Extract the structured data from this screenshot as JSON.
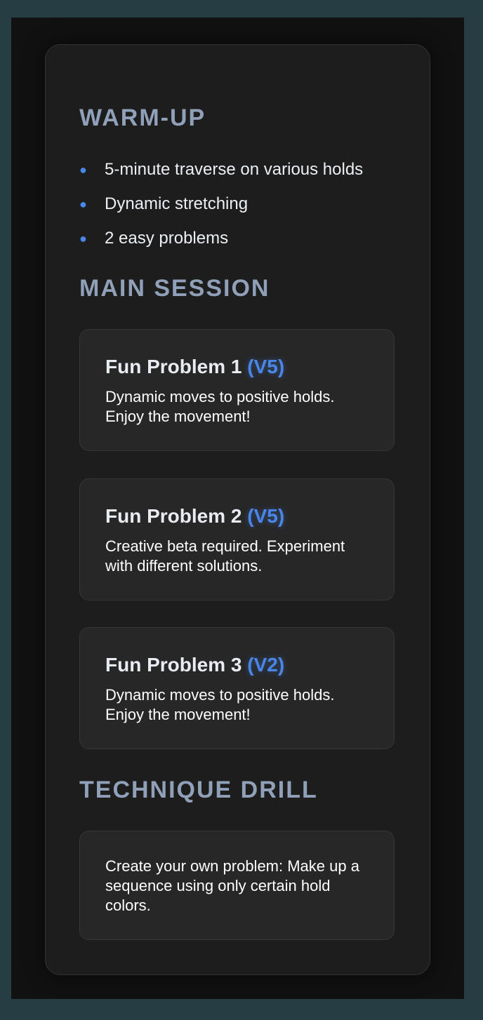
{
  "colors": {
    "page_background": "#263d43",
    "frame_background": "#111111",
    "card_background": "#1d1d1d",
    "panel_background": "#272727",
    "heading": "#8fa0b8",
    "accent": "#4a86e8",
    "text": "#ffffff"
  },
  "warmup": {
    "title": "WARM-UP",
    "items": [
      {
        "icon": "bullet",
        "label": "5-minute traverse on various holds"
      },
      {
        "icon": "bullet",
        "label": "Dynamic stretching"
      },
      {
        "icon": "bullet",
        "label": "2 easy problems"
      }
    ]
  },
  "main_session": {
    "title": "MAIN SESSION",
    "problems": [
      {
        "name": "Fun Problem 1",
        "grade": "(V5)",
        "description": "Dynamic moves to positive holds. Enjoy the movement!"
      },
      {
        "name": "Fun Problem 2",
        "grade": "(V5)",
        "description": "Creative beta required. Experiment with different solutions."
      },
      {
        "name": "Fun Problem 3",
        "grade": "(V2)",
        "description": "Dynamic moves to positive holds. Enjoy the movement!"
      }
    ]
  },
  "technique_drill": {
    "title": "TECHNIQUE DRILL",
    "description": "Create your own problem: Make up a sequence using only certain hold colors."
  }
}
